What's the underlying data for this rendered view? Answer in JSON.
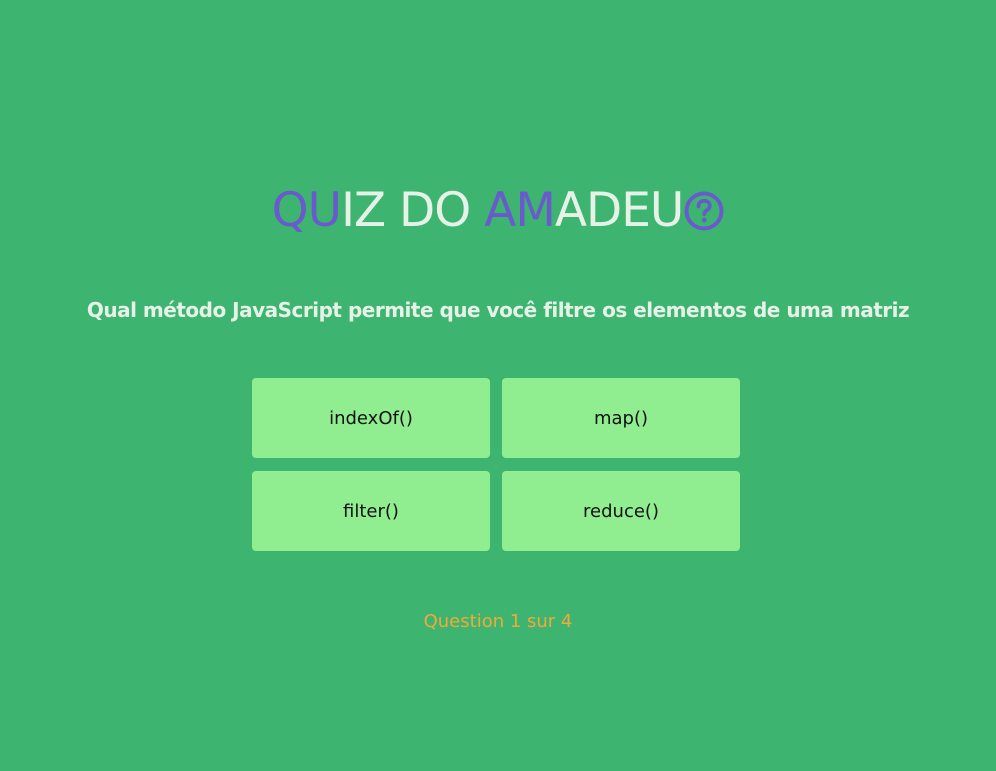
{
  "title": {
    "segments": [
      {
        "text": "QU",
        "color": "#6a5acd"
      },
      {
        "text": "IZ DO ",
        "color": "#e6f2e8"
      },
      {
        "text": "AM",
        "color": "#6a5acd"
      },
      {
        "text": "ADEU",
        "color": "#e6f2e8"
      }
    ],
    "icon": "question-circle-icon",
    "icon_color": "#6a5acd"
  },
  "question": "Qual método JavaScript permite que você filtre os elementos de uma matriz",
  "answers": [
    "indexOf()",
    "map()",
    "filter()",
    "reduce()"
  ],
  "progress": {
    "text": "Question 1 sur 4",
    "color": "#f2a93b"
  },
  "colors": {
    "background": "#3db570",
    "answer_background": "#90ee90",
    "answer_text": "#111111",
    "question_text": "#e6f2e8"
  }
}
